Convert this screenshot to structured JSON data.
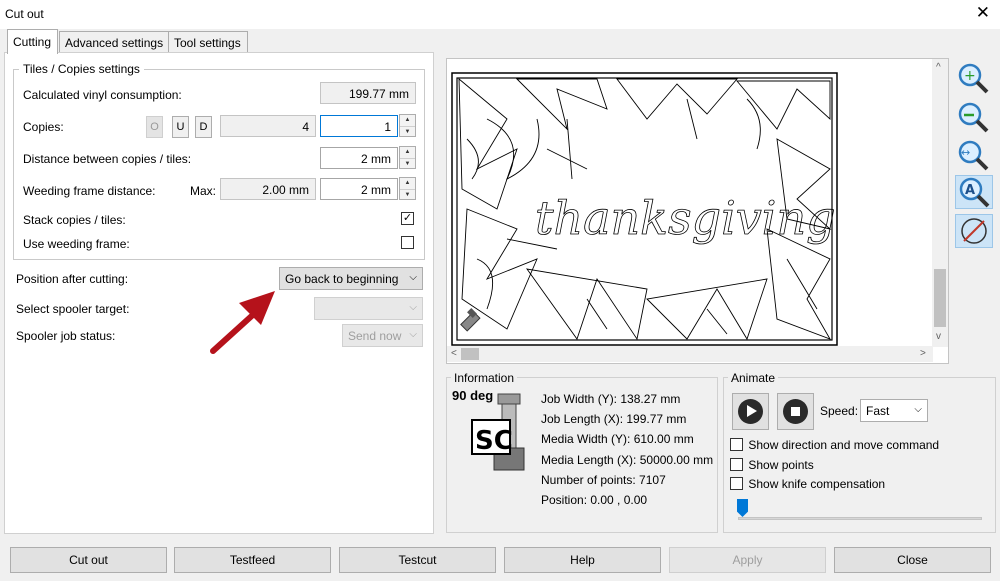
{
  "window": {
    "title": "Cut out"
  },
  "tabs": [
    {
      "label": "Cutting"
    },
    {
      "label": "Advanced settings"
    },
    {
      "label": "Tool settings"
    }
  ],
  "tiles": {
    "group_title": "Tiles / Copies settings",
    "vinyl_label": "Calculated vinyl consumption:",
    "vinyl_value": "199.77 mm",
    "copies_label": "Copies:",
    "copies_modes": [
      "O",
      "U",
      "D"
    ],
    "copies_total": "4",
    "copies_value": "1",
    "distance_label": "Distance between copies / tiles:",
    "distance_value": "2 mm",
    "weeding_label": "Weeding frame distance:",
    "max_label": "Max:",
    "max_value": "2.00 mm",
    "weeding_value": "2 mm",
    "stack_label": "Stack copies / tiles:",
    "stack_checked": true,
    "use_weeding_label": "Use weeding frame:",
    "use_weeding_checked": false
  },
  "position": {
    "label": "Position after cutting:",
    "value": "Go back to beginning"
  },
  "spooler": {
    "target_label": "Select spooler target:",
    "target_value": "",
    "status_label": "Spooler job status:",
    "status_value": "Send now"
  },
  "preview": {
    "text": "thanksgiving"
  },
  "toolbar_icons": [
    "zoom-in-icon",
    "zoom-out-icon",
    "zoom-fit-width-icon",
    "auto-text-icon",
    "no-selection-icon"
  ],
  "information": {
    "title": "Information",
    "rotation": "90 deg",
    "logo_text": "SC",
    "lines": [
      "Job Width (Y): 138.27 mm",
      "Job Length (X): 199.77 mm",
      "Media Width (Y): 610.00 mm",
      "Media Length (X): 50000.00 mm",
      "Number of points: 7107",
      "Position: 0.00 , 0.00"
    ]
  },
  "animate": {
    "title": "Animate",
    "speed_label": "Speed:",
    "speed_value": "Fast",
    "options": [
      {
        "label": "Show direction and move command",
        "checked": false
      },
      {
        "label": "Show points",
        "checked": false
      },
      {
        "label": "Show knife compensation",
        "checked": false
      }
    ],
    "progress": 0
  },
  "buttons": {
    "cut_out": "Cut out",
    "testfeed": "Testfeed",
    "testcut": "Testcut",
    "help": "Help",
    "apply": "Apply",
    "close": "Close"
  },
  "colors": {
    "accent": "#0078d7",
    "arrow": "#b5121b",
    "selection": "#cce4f7"
  }
}
